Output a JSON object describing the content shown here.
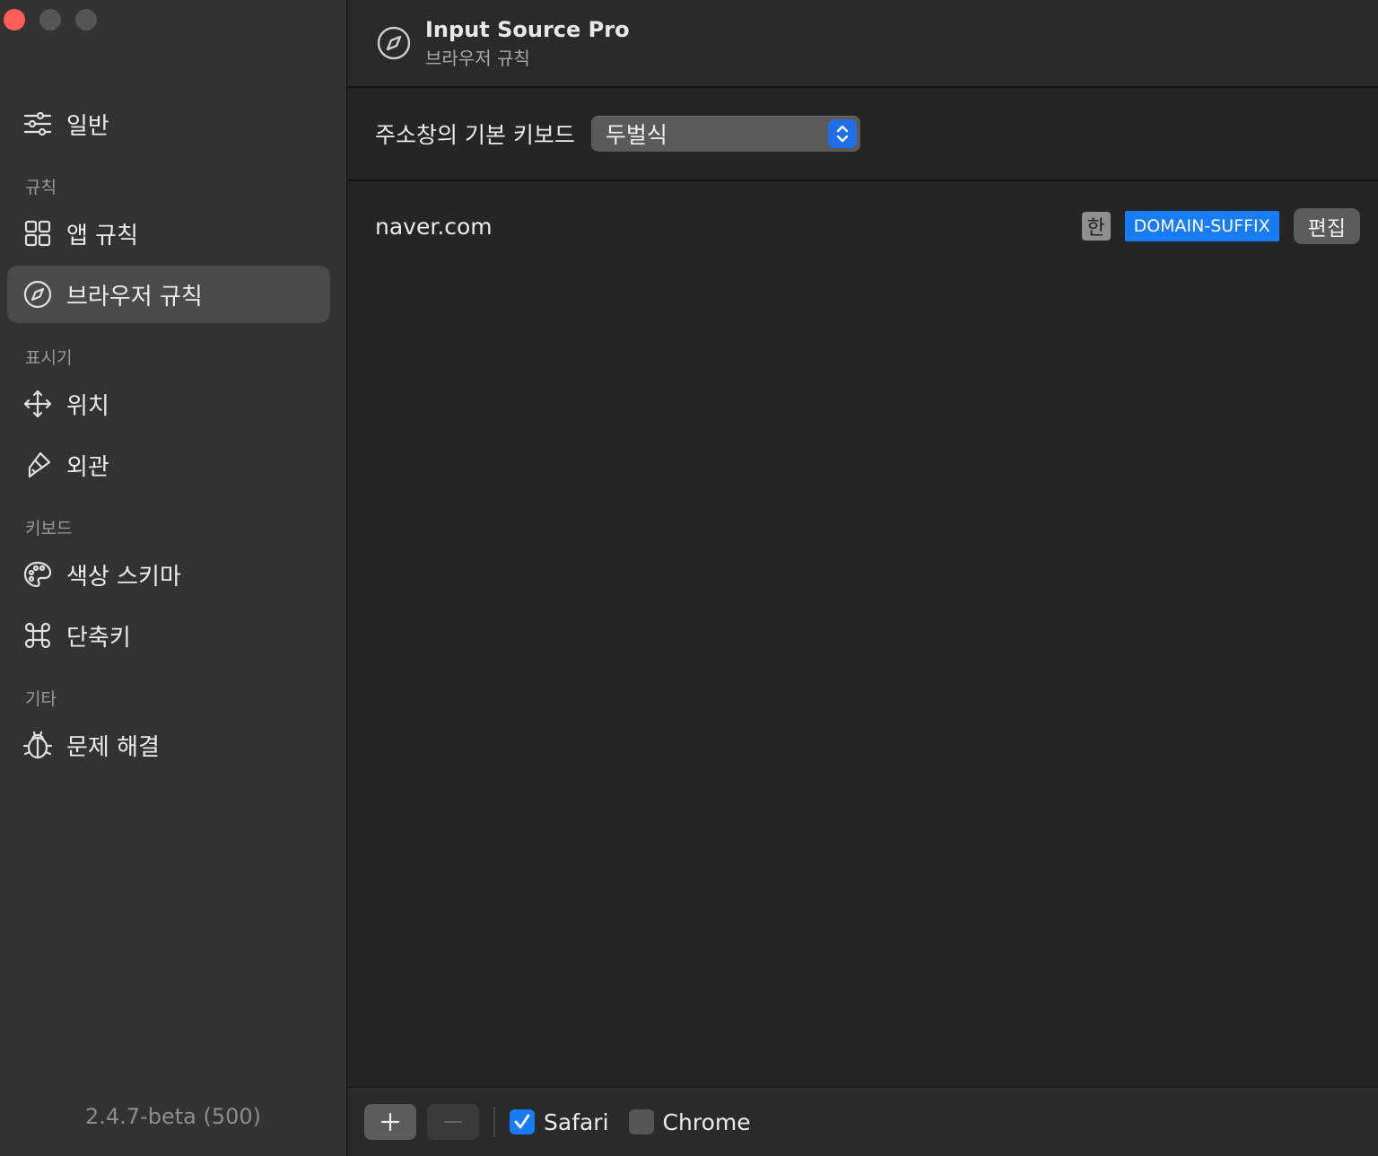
{
  "window": {
    "app_title": "Input Source Pro",
    "page_subtitle": "브라우저 규칙",
    "colors": {
      "accent": "#1a7cf5",
      "close": "#ff5f57",
      "sidebar_bg": "#323232",
      "main_bg": "#252525"
    }
  },
  "sidebar": {
    "general": {
      "label": "일반",
      "icon": "sliders-icon"
    },
    "sections": [
      {
        "title": "규칙",
        "items": [
          {
            "label": "앱 규칙",
            "icon": "grid-icon"
          },
          {
            "label": "브라우저 규칙",
            "icon": "compass-icon",
            "active": true
          }
        ]
      },
      {
        "title": "표시기",
        "items": [
          {
            "label": "위치",
            "icon": "move-icon"
          },
          {
            "label": "외관",
            "icon": "paintbrush-icon"
          }
        ]
      },
      {
        "title": "키보드",
        "items": [
          {
            "label": "색상 스키마",
            "icon": "palette-icon"
          },
          {
            "label": "단축키",
            "icon": "command-icon"
          }
        ]
      },
      {
        "title": "기타",
        "items": [
          {
            "label": "문제 해결",
            "icon": "ladybug-icon"
          }
        ]
      }
    ],
    "version": "2.4.7-beta (500)"
  },
  "main": {
    "address_bar_setting": {
      "label": "주소창의 기본 키보드",
      "selected": "두벌식"
    },
    "rules": [
      {
        "domain": "naver.com",
        "input_badge": "한",
        "match_type": "DOMAIN-SUFFIX",
        "edit_label": "편집"
      }
    ],
    "bottom_bar": {
      "add_symbol": "+",
      "remove_symbol": "—",
      "browsers": [
        {
          "label": "Safari",
          "checked": true
        },
        {
          "label": "Chrome",
          "checked": false
        }
      ]
    }
  }
}
